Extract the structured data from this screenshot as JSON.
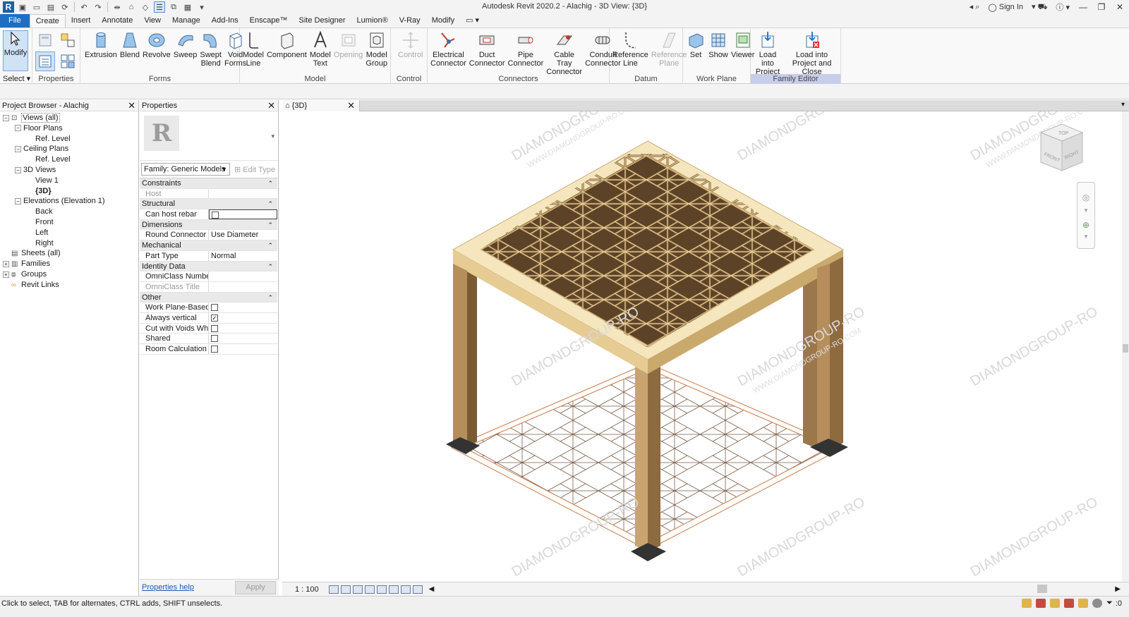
{
  "app": {
    "title": "Autodesk Revit 2020.2 - Alachig - 3D View: {3D}",
    "sign_in": "Sign In"
  },
  "menu_tabs": [
    {
      "label": "File"
    },
    {
      "label": "Create"
    },
    {
      "label": "Insert"
    },
    {
      "label": "Annotate"
    },
    {
      "label": "View"
    },
    {
      "label": "Manage"
    },
    {
      "label": "Add-Ins"
    },
    {
      "label": "Enscape™"
    },
    {
      "label": "Site Designer"
    },
    {
      "label": "Lumion®"
    },
    {
      "label": "V-Ray"
    },
    {
      "label": "Modify"
    }
  ],
  "ribbon": {
    "select": {
      "modify": "Modify",
      "title": "Select ▾"
    },
    "properties": {
      "title": "Properties"
    },
    "forms": {
      "title": "Forms",
      "buttons": [
        "Extrusion",
        "Blend",
        "Revolve",
        "Sweep",
        "Swept\nBlend",
        "Void\nForms"
      ]
    },
    "model": {
      "title": "Model",
      "buttons": [
        "Model\nLine",
        "Component",
        "Model\nText",
        "Opening",
        "Model\nGroup"
      ]
    },
    "control": {
      "title": "Control",
      "buttons": [
        "Control"
      ]
    },
    "connectors": {
      "title": "Connectors",
      "buttons": [
        "Electrical\nConnector",
        "Duct\nConnector",
        "Pipe\nConnector",
        "Cable Tray\nConnector",
        "Conduit\nConnector"
      ]
    },
    "datum": {
      "title": "Datum",
      "buttons": [
        "Reference\nLine",
        "Reference\nPlane"
      ]
    },
    "workplane": {
      "title": "Work Plane",
      "buttons": [
        "Set",
        "Show",
        "Viewer"
      ]
    },
    "family_editor": {
      "title": "Family Editor",
      "buttons": [
        "Load into\nProject",
        "Load into\nProject and Close"
      ]
    }
  },
  "project_browser": {
    "title": "Project Browser - Alachig",
    "nodes": [
      {
        "label": "Views (all)",
        "level": 0,
        "toggle": "−",
        "icon": "views"
      },
      {
        "label": "Floor Plans",
        "level": 1,
        "toggle": "−"
      },
      {
        "label": "Ref. Level",
        "level": 2
      },
      {
        "label": "Ceiling Plans",
        "level": 1,
        "toggle": "−"
      },
      {
        "label": "Ref. Level",
        "level": 2
      },
      {
        "label": "3D Views",
        "level": 1,
        "toggle": "−"
      },
      {
        "label": "View 1",
        "level": 2
      },
      {
        "label": "{3D}",
        "level": 2,
        "bold": true
      },
      {
        "label": "Elevations (Elevation 1)",
        "level": 1,
        "toggle": "−"
      },
      {
        "label": "Back",
        "level": 2
      },
      {
        "label": "Front",
        "level": 2
      },
      {
        "label": "Left",
        "level": 2
      },
      {
        "label": "Right",
        "level": 2
      },
      {
        "label": "Sheets (all)",
        "level": 0,
        "icon": "sheets"
      },
      {
        "label": "Families",
        "level": 0,
        "toggle": "+",
        "icon": "families"
      },
      {
        "label": "Groups",
        "level": 0,
        "toggle": "+",
        "icon": "groups"
      },
      {
        "label": "Revit Links",
        "level": 0,
        "icon": "links"
      }
    ]
  },
  "properties": {
    "title": "Properties",
    "family": "Family: Generic Models",
    "edit_type": "Edit Type",
    "help": "Properties help",
    "apply": "Apply",
    "rows": [
      {
        "type": "cat",
        "label": "Constraints"
      },
      {
        "type": "prop",
        "key": "Host",
        "value": "",
        "disabled": true
      },
      {
        "type": "cat",
        "label": "Structural"
      },
      {
        "type": "check",
        "key": "Can host rebar",
        "checked": false
      },
      {
        "type": "cat",
        "label": "Dimensions"
      },
      {
        "type": "prop",
        "key": "Round Connector ...",
        "value": "Use Diameter"
      },
      {
        "type": "cat",
        "label": "Mechanical"
      },
      {
        "type": "prop",
        "key": "Part Type",
        "value": "Normal"
      },
      {
        "type": "cat",
        "label": "Identity Data"
      },
      {
        "type": "prop",
        "key": "OmniClass Number",
        "value": ""
      },
      {
        "type": "prop",
        "key": "OmniClass Title",
        "value": "",
        "disabled": true
      },
      {
        "type": "cat",
        "label": "Other"
      },
      {
        "type": "check",
        "key": "Work Plane-Based",
        "checked": false
      },
      {
        "type": "check",
        "key": "Always vertical",
        "checked": true
      },
      {
        "type": "check",
        "key": "Cut with Voids Wh...",
        "checked": false
      },
      {
        "type": "check",
        "key": "Shared",
        "checked": false
      },
      {
        "type": "check",
        "key": "Room Calculation ...",
        "checked": false
      }
    ]
  },
  "view": {
    "tab_label": "{3D}",
    "scale": "1 : 100",
    "viewcube": {
      "top": "TOP",
      "front": "FRONT",
      "right": "RIGHT"
    },
    "watermark": "DIAMONDGROUP-RO",
    "watermark_url": "WWW.DIAMONDGROUP-RO.COM"
  },
  "status": {
    "text": "Click to select, TAB for alternates, CTRL adds, SHIFT unselects.",
    "filter_count": ":0"
  },
  "colors": {
    "accent": "#1e6fc2",
    "wood_light": "#f3e1b0",
    "wood_dark": "#8a6c45",
    "family_editor": "#c7cdea",
    "projection": "#c97a4a"
  }
}
